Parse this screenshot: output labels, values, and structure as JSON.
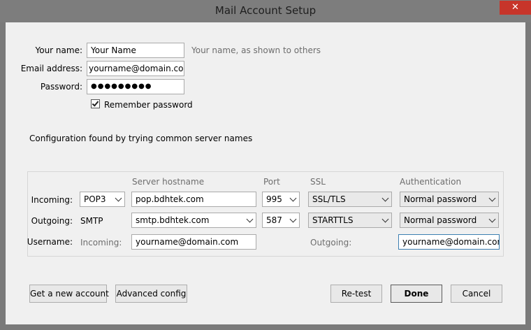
{
  "window": {
    "title": "Mail Account Setup",
    "close_symbol": "✕"
  },
  "identity": {
    "name_label": "Your name:",
    "name_value": "Your Name",
    "name_hint": "Your name, as shown to others",
    "email_label": "Email address:",
    "email_value": "yourname@domain.com",
    "password_label": "Password:",
    "password_value": "●●●●●●●●●",
    "remember_label": "Remember password",
    "remember_checked": true
  },
  "status": "Configuration found by trying common server names",
  "server": {
    "headers": {
      "hostname": "Server hostname",
      "port": "Port",
      "ssl": "SSL",
      "auth": "Authentication"
    },
    "incoming": {
      "label": "Incoming:",
      "protocol": "POP3",
      "hostname": "pop.bdhtek.com",
      "port": "995",
      "ssl": "SSL/TLS",
      "auth": "Normal password"
    },
    "outgoing": {
      "label": "Outgoing:",
      "protocol": "SMTP",
      "hostname": "smtp.bdhtek.com",
      "port": "587",
      "ssl": "STARTTLS",
      "auth": "Normal password"
    },
    "username": {
      "label": "Username:",
      "incoming_label": "Incoming:",
      "incoming_value": "yourname@domain.com",
      "outgoing_label": "Outgoing:",
      "outgoing_value": "yourname@domain.com"
    }
  },
  "buttons": {
    "new_account": "Get a new account",
    "advanced": "Advanced config",
    "retest": "Re-test",
    "done": "Done",
    "cancel": "Cancel"
  }
}
